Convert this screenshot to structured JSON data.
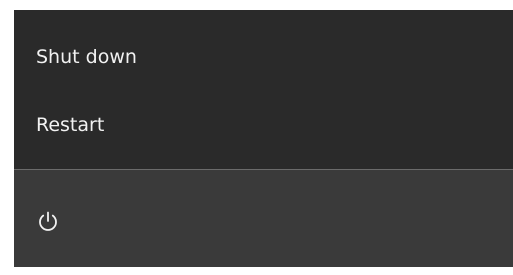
{
  "power_menu": {
    "items": [
      {
        "label": "Shut down"
      },
      {
        "label": "Restart"
      }
    ]
  },
  "power_button": {
    "icon": "power-icon"
  },
  "colors": {
    "menu_background": "#2a2a2a",
    "bottom_background": "#3a3a3a",
    "text": "#f2f2f2",
    "divider": "#6b6b6b"
  }
}
